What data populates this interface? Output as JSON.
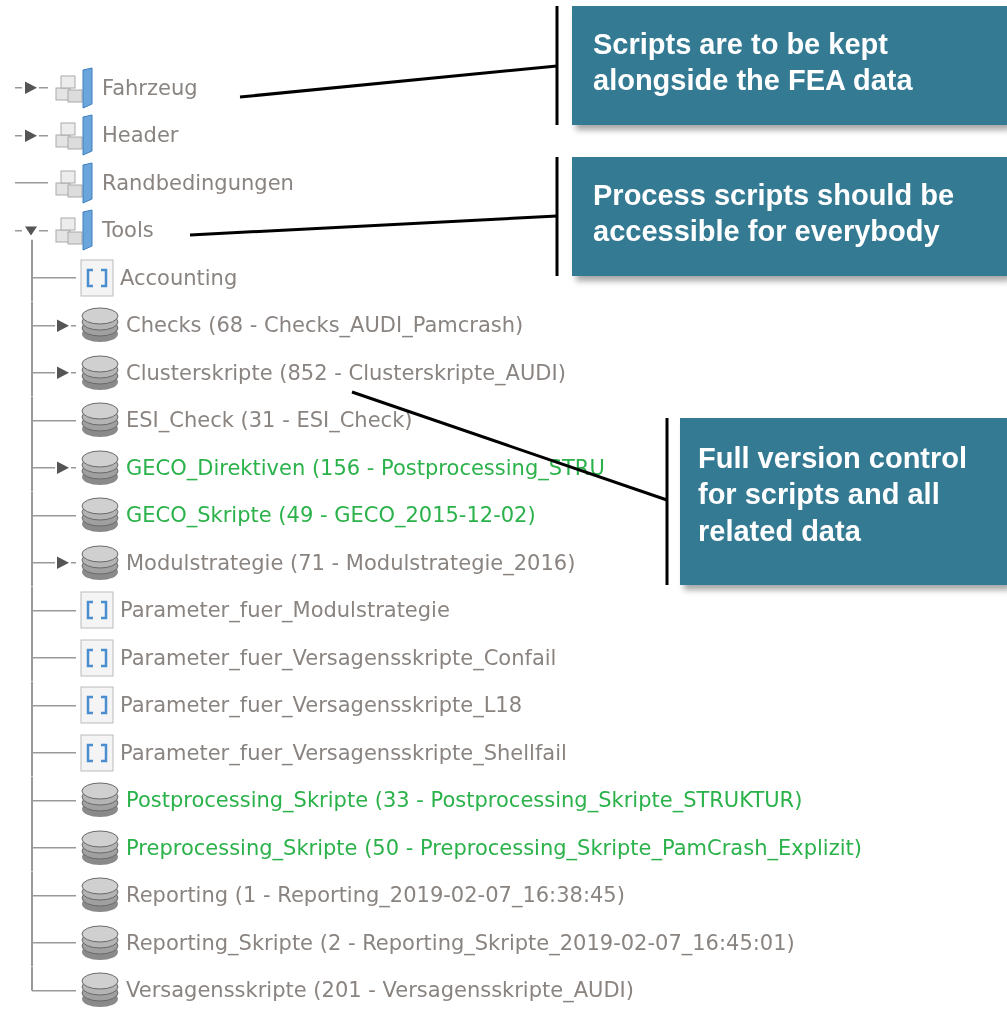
{
  "tree": {
    "items": [
      {
        "name": "Fahrzeug",
        "kind": "package",
        "expanded": false,
        "highlighted": false
      },
      {
        "name": "Header",
        "kind": "package",
        "expanded": false,
        "highlighted": false
      },
      {
        "name": "Randbedingungen",
        "kind": "package",
        "highlighted": false
      },
      {
        "name": "Tools",
        "kind": "package",
        "expanded": true,
        "highlighted": false,
        "children": [
          {
            "name": "Accounting",
            "kind": "script",
            "highlighted": false
          },
          {
            "name": "Checks (68 - Checks_AUDI_Pamcrash)",
            "kind": "database",
            "expanded": false,
            "highlighted": false
          },
          {
            "name": "Clusterskripte (852 - Clusterskripte_AUDI)",
            "kind": "database",
            "expanded": false,
            "highlighted": false
          },
          {
            "name": "ESI_Check (31 - ESI_Check)",
            "kind": "database",
            "highlighted": false
          },
          {
            "name": "GECO_Direktiven (156 - Postprocessing_STRU",
            "kind": "database",
            "expanded": false,
            "highlighted": true
          },
          {
            "name": "GECO_Skripte (49 - GECO_2015-12-02)",
            "kind": "database",
            "highlighted": true
          },
          {
            "name": "Modulstrategie (71 - Modulstrategie_2016)",
            "kind": "database",
            "expanded": false,
            "highlighted": false
          },
          {
            "name": "Parameter_fuer_Modulstrategie",
            "kind": "script",
            "highlighted": false
          },
          {
            "name": "Parameter_fuer_Versagensskripte_Confail",
            "kind": "script",
            "highlighted": false
          },
          {
            "name": "Parameter_fuer_Versagensskripte_L18",
            "kind": "script",
            "highlighted": false
          },
          {
            "name": "Parameter_fuer_Versagensskripte_Shellfail",
            "kind": "script",
            "highlighted": false
          },
          {
            "name": "Postprocessing_Skripte (33 - Postprocessing_Skripte_STRUKTUR)",
            "kind": "database",
            "highlighted": true
          },
          {
            "name": "Preprocessing_Skripte (50 - Preprocessing_Skripte_PamCrash_Explizit)",
            "kind": "database",
            "highlighted": true
          },
          {
            "name": "Reporting (1 - Reporting_2019-02-07_16:38:45)",
            "kind": "database",
            "highlighted": false
          },
          {
            "name": "Reporting_Skripte (2 - Reporting_Skripte_2019-02-07_16:45:01)",
            "kind": "database",
            "highlighted": false
          },
          {
            "name": "Versagensskripte (201 - Versagensskripte_AUDI)",
            "kind": "database",
            "highlighted": false
          }
        ]
      }
    ]
  },
  "callouts": [
    {
      "text": "Scripts are to be kept alongside the FEA data"
    },
    {
      "text": "Process scripts should be accessible for everybody"
    },
    {
      "text": "Full version control for scripts and all related data"
    }
  ]
}
